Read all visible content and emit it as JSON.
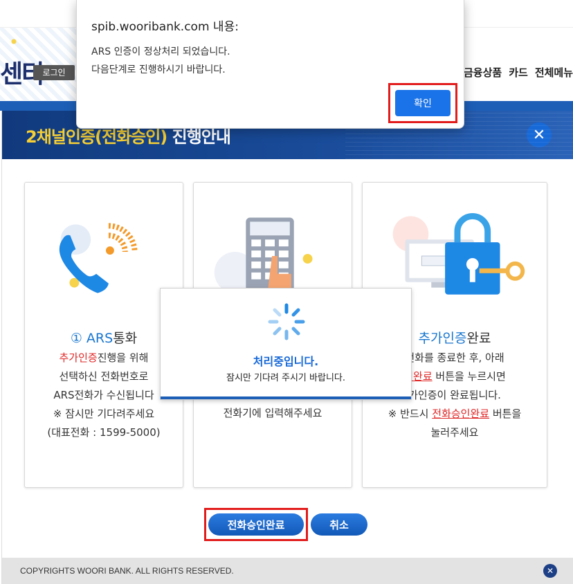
{
  "site": {
    "logo_text": "센터",
    "login_label": "로그인",
    "nav": [
      "금융상품",
      "카드",
      "전체메뉴"
    ]
  },
  "modal": {
    "title_highlight": "2채널인증(전화승인)",
    "title_rest": " 진행안내",
    "close_label": "✕",
    "cards": [
      {
        "step_title_blue": "① ARS",
        "step_title_rest": "통화",
        "desc_red": "추가인증",
        "desc_after_red": "진행을 위해",
        "desc_lines": [
          "선택하신 전화번호로",
          "ARS전화가 수신됩니다",
          "※ 잠시만 기다려주세요",
          "(대표전화 : 1599-5000)"
        ]
      },
      {
        "desc_lines": [
          "전화기에 입력해주세요"
        ]
      },
      {
        "step_title_blue": "추가인증",
        "step_title_rest": "완료",
        "desc_line1": "전화를 종료한 후, 아래",
        "desc_line2_red": "인완료",
        "desc_line2_rest": " 버튼을 누르시면",
        "desc_line3": "가인증이 완료됩니다.",
        "desc_line4_prefix": "※ 반드시 ",
        "desc_line4_red": "전화승인완료",
        "desc_line4_rest": " 버튼을",
        "desc_line5": "눌러주세요"
      }
    ],
    "confirm_button": "전화승인완료",
    "cancel_button": "취소",
    "copyright": "COPYRIGHTS WOORI BANK. ALL RIGHTS RESERVED.",
    "footer_close": "✕"
  },
  "loading": {
    "title": "처리중입니다.",
    "subtitle": "잠시만 기다려 주시기 바랍니다."
  },
  "alert": {
    "origin": "spib.wooribank.com 내용:",
    "message_lines": [
      "ARS 인증이 정상처리 되었습니다.",
      "다음단계로 진행하시기 바랍니다."
    ],
    "ok_button": "확인"
  },
  "colors": {
    "brand_blue": "#1769d8",
    "header_navy": "#113a7d",
    "highlight_yellow": "#f6cf34",
    "annotation_red": "#e21b1b"
  },
  "icons": [
    "phone-icon",
    "keypad-icon",
    "lock-icon",
    "spinner-icon",
    "close-icon"
  ]
}
